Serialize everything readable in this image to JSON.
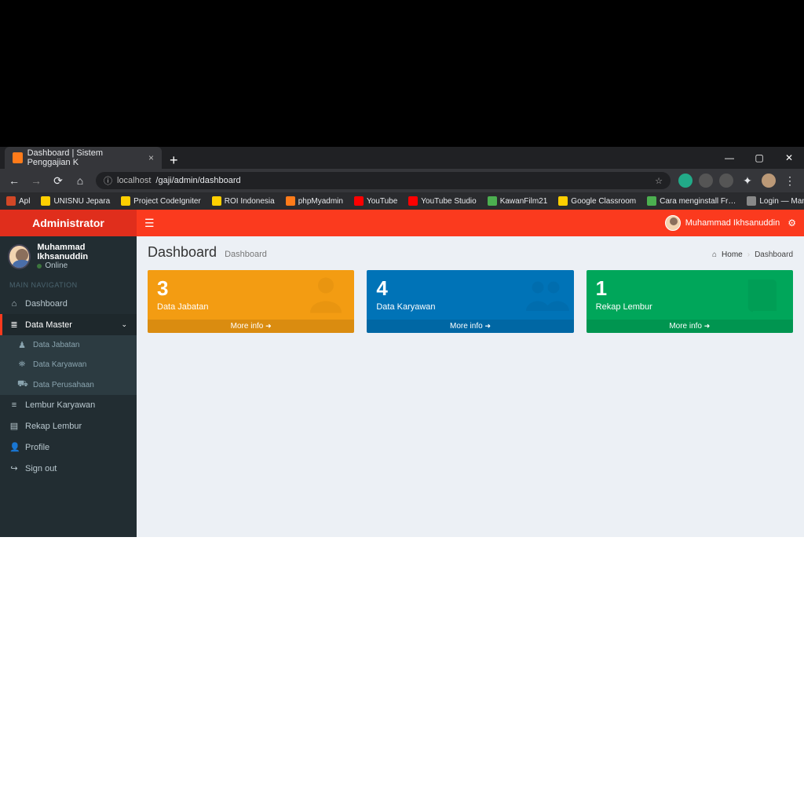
{
  "browser": {
    "tab_title": "Dashboard | Sistem Penggajian K",
    "url_domain": "localhost",
    "url_path": "/gaji/admin/dashboard",
    "bookmarks": [
      "Apl",
      "UNISNU Jepara",
      "Project CodeIgniter",
      "ROI Indonesia",
      "phpMyadmin",
      "YouTube",
      "YouTube Studio",
      "KawanFilm21",
      "Google Classroom",
      "Cara menginstall Fr…",
      "Login — Manajeme…"
    ],
    "bookmark_colors": [
      "#d24726",
      "#ffcf00",
      "#ffcf00",
      "#ffcf00",
      "#ff7b1a",
      "#ff0000",
      "#ff0000",
      "#4caf50",
      "#ffcf00",
      "#4caf50",
      "#888"
    ]
  },
  "app": {
    "brand": "Administrator",
    "user": {
      "name": "Muhammad Ikhsanuddin",
      "status": "Online"
    },
    "nav_header": "MAIN NAVIGATION",
    "menu": [
      {
        "icon": "⌂",
        "label": "Dashboard"
      },
      {
        "icon": "≣",
        "label": "Data Master",
        "expandable": true,
        "open": true,
        "sub": [
          {
            "icon": "♟",
            "label": "Data Jabatan"
          },
          {
            "icon": "⛯",
            "label": "Data Karyawan"
          },
          {
            "icon": "⛟",
            "label": "Data Perusahaan"
          }
        ]
      },
      {
        "icon": "≡",
        "label": "Lembur Karyawan"
      },
      {
        "icon": "▤",
        "label": "Rekap Lembur"
      },
      {
        "icon": "👤",
        "label": "Profile"
      },
      {
        "icon": "↪",
        "label": "Sign out"
      }
    ],
    "page": {
      "title": "Dashboard",
      "subtitle": "Dashboard"
    },
    "breadcrumb": {
      "home": "Home",
      "current": "Dashboard"
    },
    "cards": [
      {
        "value": "3",
        "label": "Data Jabatan",
        "more": "More info",
        "color": "orange",
        "icon": "doctor"
      },
      {
        "value": "4",
        "label": "Data Karyawan",
        "more": "More info",
        "color": "blue",
        "icon": "users"
      },
      {
        "value": "1",
        "label": "Rekap Lembur",
        "more": "More info",
        "color": "green",
        "icon": "book"
      }
    ]
  }
}
